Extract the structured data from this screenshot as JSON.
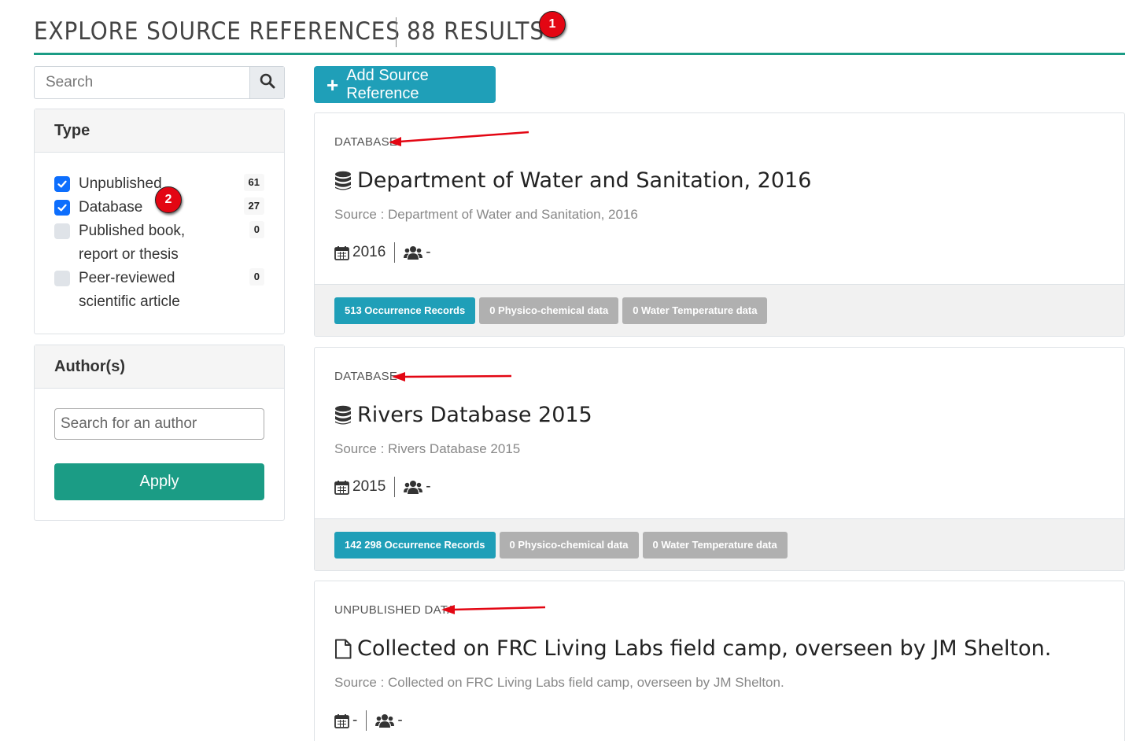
{
  "header": {
    "title": "EXPLORE SOURCE REFERENCES",
    "results": "88 RESULTS",
    "marker": "1"
  },
  "sidebar": {
    "search": {
      "placeholder": "Search",
      "icon": "search-icon"
    },
    "type_panel": {
      "title": "Type",
      "marker": "2",
      "items": [
        {
          "label": "Unpublished",
          "count": "61",
          "checked": true
        },
        {
          "label": "Database",
          "count": "27",
          "checked": true
        },
        {
          "label": "Published book, report or thesis",
          "count": "0",
          "checked": false
        },
        {
          "label": "Peer-reviewed scientific article",
          "count": "0",
          "checked": false
        }
      ]
    },
    "author_panel": {
      "title": "Author(s)",
      "placeholder": "Search for an author",
      "apply_label": "Apply"
    }
  },
  "toolbar": {
    "add_label": "Add Source Reference"
  },
  "cards": [
    {
      "type": "DATABASE",
      "icon": "database-icon",
      "title": "Department of Water and Sanitation, 2016",
      "source": "Source : Department of Water and Sanitation, 2016",
      "year": "2016",
      "authors": "-",
      "badges": [
        "513 Occurrence Records",
        "0 Physico-chemical data",
        "0 Water Temperature data"
      ]
    },
    {
      "type": "DATABASE",
      "icon": "database-icon",
      "title": "Rivers Database 2015",
      "source": "Source : Rivers Database 2015",
      "year": "2015",
      "authors": "-",
      "badges": [
        "142 298 Occurrence Records",
        "0 Physico-chemical data",
        "0 Water Temperature data"
      ]
    },
    {
      "type": "UNPUBLISHED DATA",
      "icon": "file-icon",
      "title": "Collected on FRC Living Labs field camp, overseen by JM Shelton.",
      "source": "Source : Collected on FRC Living Labs field camp, overseen by JM Shelton.",
      "year": "-",
      "authors": "-"
    }
  ],
  "colors": {
    "accent": "#1b9c85",
    "primary": "#1f9fb8",
    "marker": "#e30613",
    "checkbox": "#0d6efd"
  }
}
